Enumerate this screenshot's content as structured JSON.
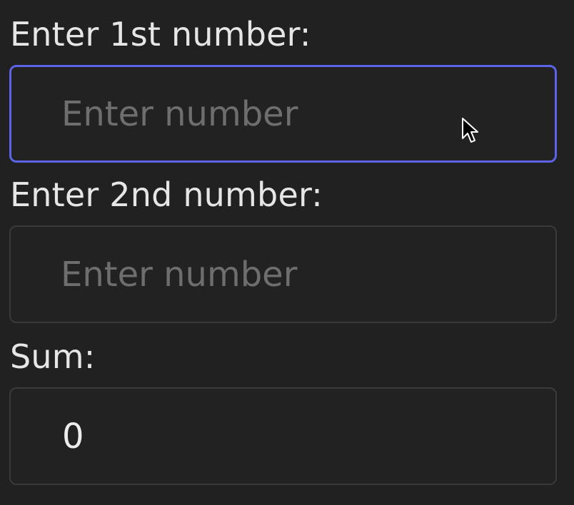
{
  "form": {
    "first": {
      "label": "Enter 1st number:",
      "placeholder": "Enter number",
      "value": ""
    },
    "second": {
      "label": "Enter 2nd number:",
      "placeholder": "Enter number",
      "value": ""
    },
    "sum": {
      "label": "Sum:",
      "value": "0"
    }
  },
  "colors": {
    "background": "#212121",
    "focus_border": "#5d63e6",
    "border": "#3a3a3a",
    "text": "#e6e6e6",
    "placeholder": "#6e6e6e"
  },
  "icons": {
    "pointer": "mouse-pointer-icon"
  }
}
